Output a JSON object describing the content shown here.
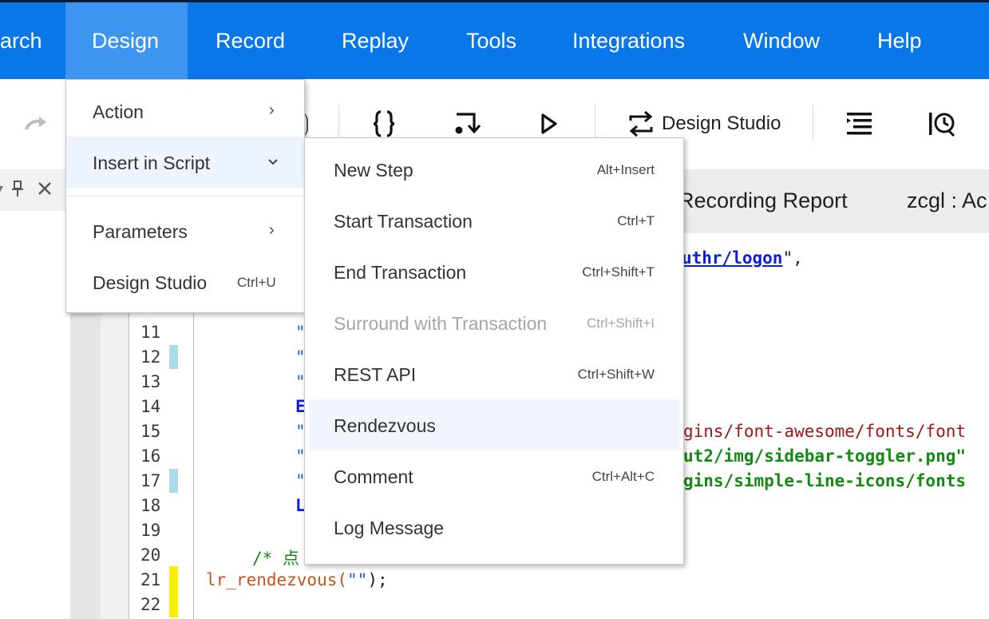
{
  "menubar": {
    "items": [
      {
        "label": "arch"
      },
      {
        "label": "Design"
      },
      {
        "label": "Record"
      },
      {
        "label": "Replay"
      },
      {
        "label": "Tools"
      },
      {
        "label": "Integrations"
      },
      {
        "label": "Window"
      },
      {
        "label": "Help"
      }
    ],
    "active": "Design",
    "color": "#0a77e8",
    "active_color": "#3e95f0"
  },
  "toolbar": {
    "design_studio_label": "Design Studio",
    "icons": [
      "redo-arrow-icon",
      "braces-icon",
      "step-into-icon",
      "play-icon",
      "design-studio-icon",
      "outline-list-icon",
      "history-clock-icon"
    ]
  },
  "tabs": [
    {
      "label": "Recording Report"
    },
    {
      "label": "zcgl : Ac"
    }
  ],
  "design_menu": {
    "items": [
      {
        "label": "Action",
        "shortcut": "",
        "has_submenu": true
      },
      {
        "label": "Insert in Script",
        "shortcut": "",
        "expanded": true
      },
      {
        "label": "Parameters",
        "shortcut": "",
        "has_submenu": true
      },
      {
        "label": "Design Studio",
        "shortcut": "Ctrl+U"
      }
    ]
  },
  "insert_menu": {
    "items": [
      {
        "label": "New Step",
        "shortcut": "Alt+Insert"
      },
      {
        "label": "Start Transaction",
        "shortcut": "Ctrl+T"
      },
      {
        "label": "End Transaction",
        "shortcut": "Ctrl+Shift+T"
      },
      {
        "label": "Surround with Transaction",
        "shortcut": "Ctrl+Shift+I",
        "disabled": true
      },
      {
        "label": "REST API",
        "shortcut": "Ctrl+Shift+W"
      },
      {
        "label": "Rendezvous",
        "shortcut": "",
        "highlighted": true
      },
      {
        "label": "Comment",
        "shortcut": "Ctrl+Alt+C"
      },
      {
        "label": "Log Message",
        "shortcut": ""
      }
    ]
  },
  "editor": {
    "line_numbers": [
      "11",
      "12",
      "13",
      "14",
      "15",
      "16",
      "17",
      "18",
      "19",
      "20",
      "21",
      "22"
    ],
    "code": {
      "logon_link": "uthr/logon",
      "logon_tail": "\",",
      "q11": "\"",
      "q12": "\"",
      "q13": "\"",
      "kw14": "E",
      "q15": "\"",
      "q16": "\"",
      "q17": "\"",
      "kw18": "L",
      "path15": "gins/font-awesome/fonts/font",
      "path16": "ut2/img/sidebar-toggler.png\"",
      "path17": "gins/simple-line-icons/fonts",
      "comment20": "/* 点",
      "rendezvous_func": "lr_rendezvous(",
      "rendezvous_arg": "\"\"",
      "rendezvous_end": ");"
    }
  }
}
